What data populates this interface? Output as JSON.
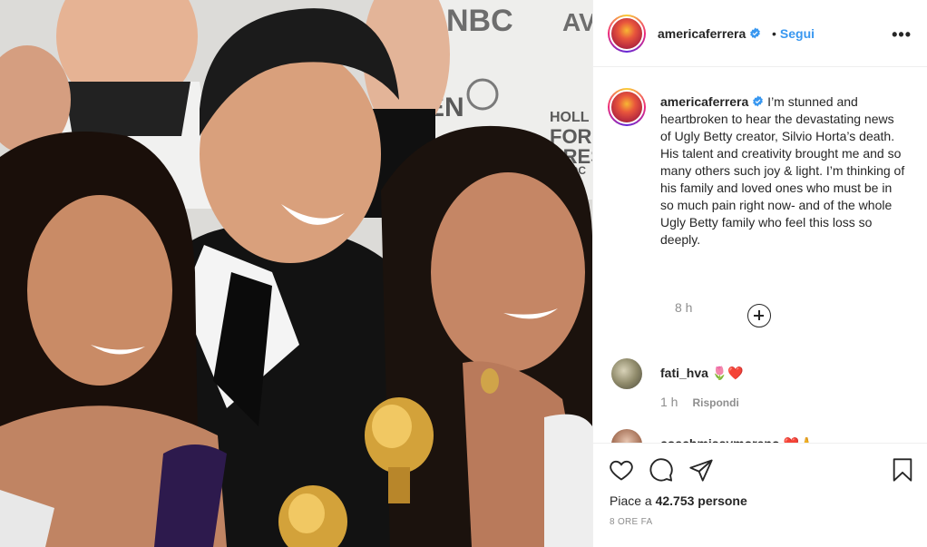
{
  "post": {
    "username": "americaferrera",
    "follow_label": "Segui",
    "follow_separator": "•",
    "more_label": "•••",
    "photo_backdrop_text": [
      "NBC",
      "AV",
      "EN",
      "HOLL",
      "FOR",
      "PRES",
      "SSOC"
    ]
  },
  "caption": {
    "username": "americaferrera",
    "text": " I’m stunned and heartbroken to hear the devastating news of Ugly Betty creator, Silvio Horta’s death. His talent and creativity brought me and so many others such joy & light. I’m thinking of his family and loved ones who must be in so much pain right now- and of the whole Ugly Betty family who feel this loss so deeply.",
    "time": "8 h"
  },
  "comments": [
    {
      "username": "fati_hva",
      "text": "🌷❤️",
      "time": "1 h",
      "reply_label": "Rispondi"
    },
    {
      "username": "coachmissymoreno",
      "text": "❤️🙏",
      "time": "",
      "reply_label": ""
    }
  ],
  "actions": {
    "likes_prefix": "Piace a ",
    "likes_count": "42.753",
    "likes_suffix": " persone",
    "posted": "8 ORE FA"
  },
  "colors": {
    "link": "#3897f0",
    "muted": "#8e8e8e",
    "text": "#262626",
    "verified": "#3897f0"
  },
  "icons": {
    "like": "heart-icon",
    "comment": "comment-bubble-icon",
    "share": "paper-plane-icon",
    "save": "bookmark-icon",
    "load_more": "plus-circle-icon",
    "verified": "verified-badge-icon"
  }
}
